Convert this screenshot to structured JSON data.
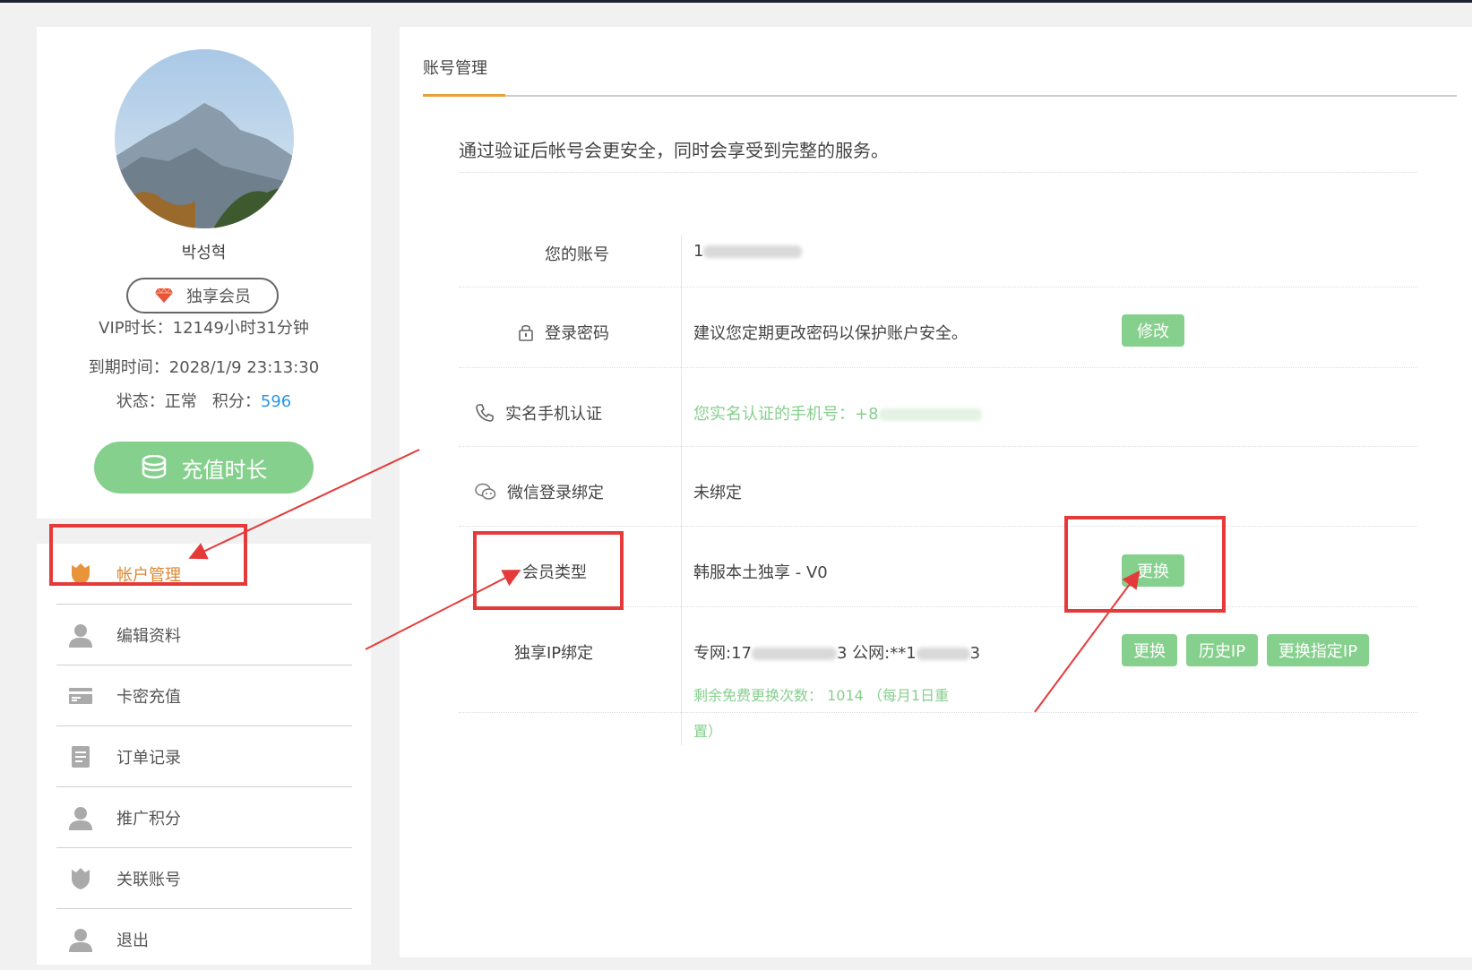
{
  "profile": {
    "username": "박성혁",
    "vip_badge_label": "独享会员",
    "vip_duration": "VIP时长：12149小时31分钟",
    "expiry": "到期时间：2028/1/9 23:13:30",
    "status_prefix": "状态：正常   积分：",
    "points": "596",
    "recharge_button": "充值时长"
  },
  "menu": {
    "items": [
      {
        "label": "帐户管理",
        "icon": "shield-icon",
        "active": true
      },
      {
        "label": "编辑资料",
        "icon": "user-icon"
      },
      {
        "label": "卡密充值",
        "icon": "card-icon"
      },
      {
        "label": "订单记录",
        "icon": "document-icon"
      },
      {
        "label": "推广积分",
        "icon": "user-icon"
      },
      {
        "label": "关联账号",
        "icon": "shield-icon"
      },
      {
        "label": "退出",
        "icon": "user-icon"
      }
    ]
  },
  "main": {
    "tab_title": "账号管理",
    "notice": "通过验证后帐号会更安全，同时会享受到完整的服务。",
    "rows": {
      "account": {
        "label": "您的账号",
        "value": "1"
      },
      "password": {
        "label": "登录密码",
        "value": "建议您定期更改密码以保护账户安全。",
        "button": "修改"
      },
      "phone": {
        "label": "实名手机认证",
        "value": "您实名认证的手机号：+8"
      },
      "wechat": {
        "label": "微信登录绑定",
        "value": "未绑定"
      },
      "member_type": {
        "label": "会员类型",
        "value": "韩服本土独享 - V0",
        "button": "更换"
      },
      "ip_binding": {
        "label": "独享IP绑定",
        "value_part1": "专网:17",
        "value_part2": "3 公网:**1",
        "value_part3": "3",
        "remaining": "剩余免费更换次数：",
        "remaining_count": "1014",
        "remaining_note": "（每月1日重",
        "remaining_note2": "置）",
        "buttons": [
          "更换",
          "历史IP",
          "更换指定IP"
        ]
      }
    }
  },
  "colors": {
    "accent_green": "#86d08d",
    "accent_orange": "#e0872f",
    "annotation_red": "#e53a3a",
    "link_blue": "#2b95e6"
  }
}
